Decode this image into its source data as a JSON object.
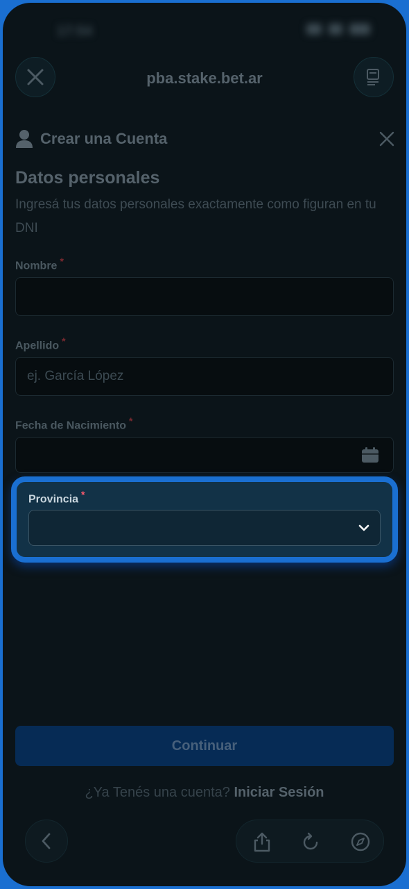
{
  "browser": {
    "url": "pba.stake.bet.ar",
    "close_icon": "close-icon",
    "tabs_icon": "tabs-icon"
  },
  "modal": {
    "title": "Crear una Cuenta",
    "user_icon": "user-icon",
    "close_icon": "close-icon"
  },
  "section": {
    "title": "Datos personales",
    "subtitle": "Ingresá tus datos personales exactamente como figuran en tu DNI"
  },
  "form": {
    "nombre": {
      "label": "Nombre",
      "required": "*",
      "value": ""
    },
    "apellido": {
      "label": "Apellido",
      "required": "*",
      "placeholder": "ej. García López"
    },
    "fecha": {
      "label": "Fecha de Nacimiento",
      "required": "*",
      "icon": "calendar-icon"
    },
    "provincia": {
      "label": "Provincia",
      "required": "*",
      "value": "",
      "icon": "chevron-down-icon"
    }
  },
  "actions": {
    "continue_label": "Continuar",
    "login_prompt": "¿Ya Tenés una cuenta?",
    "login_link": "Iniciar Sesión"
  },
  "toolbar": {
    "back_icon": "chevron-left-icon",
    "share_icon": "share-icon",
    "reload_icon": "reload-icon",
    "compass_icon": "compass-icon"
  },
  "colors": {
    "accent": "#1a6fd1",
    "background": "#0b1419",
    "required": "#ff5a6e"
  }
}
